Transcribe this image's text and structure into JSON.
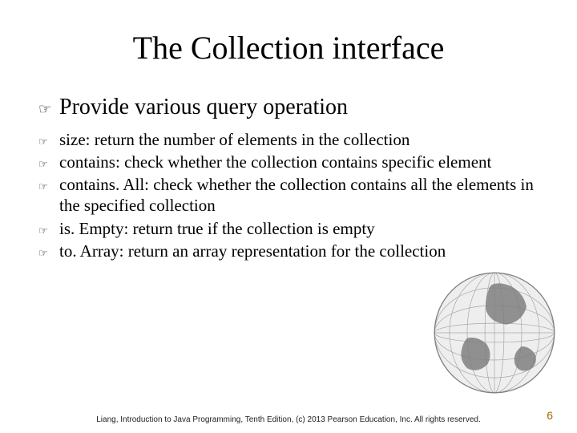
{
  "title": "The Collection interface",
  "main": {
    "bullet_glyph": "☞",
    "text": "Provide various query operation"
  },
  "subs": {
    "bullet_glyph": "☞",
    "items": [
      "size: return the number of elements in the collection",
      "contains: check whether the collection contains specific element",
      "contains. All: check whether the collection contains all the elements in the specified collection",
      "is. Empty: return true if the collection is empty",
      "to. Array: return an array representation for the collection"
    ]
  },
  "footer": "Liang, Introduction to Java Programming, Tenth Edition, (c) 2013 Pearson Education, Inc. All rights reserved.",
  "page_number": "6"
}
